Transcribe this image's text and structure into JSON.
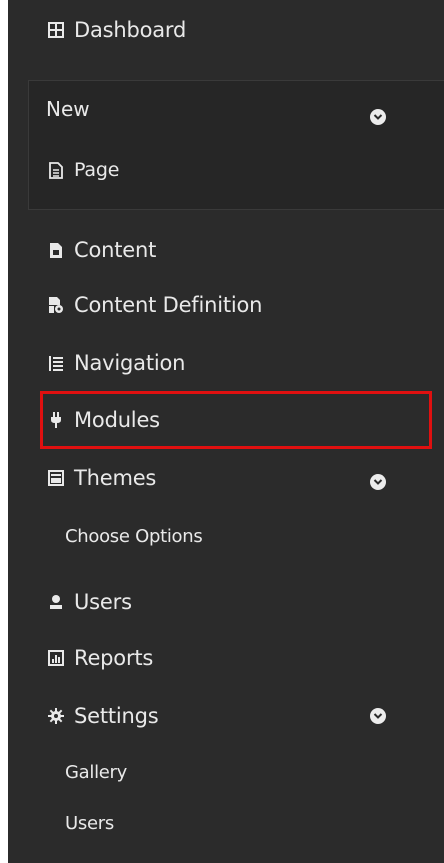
{
  "sidebar": {
    "dashboard": {
      "label": "Dashboard",
      "icon": "dashboard-icon"
    },
    "new_section": {
      "title": "New",
      "items": [
        {
          "label": "Page",
          "icon": "page-icon"
        }
      ]
    },
    "items": [
      {
        "label": "Content",
        "icon": "content-icon"
      },
      {
        "label": "Content Definition",
        "icon": "content-definition-icon"
      },
      {
        "label": "Navigation",
        "icon": "navigation-icon"
      },
      {
        "label": "Modules",
        "icon": "plug-icon",
        "highlighted": true
      },
      {
        "label": "Themes",
        "icon": "themes-icon",
        "expanded": true,
        "children": [
          {
            "label": "Choose Options"
          }
        ]
      },
      {
        "label": "Users",
        "icon": "user-icon"
      },
      {
        "label": "Reports",
        "icon": "reports-icon"
      },
      {
        "label": "Settings",
        "icon": "gear-icon",
        "expanded": true,
        "children": [
          {
            "label": "Gallery"
          },
          {
            "label": "Users"
          }
        ]
      }
    ]
  },
  "colors": {
    "background": "#2b2b2b",
    "text": "#e9e9e9",
    "highlight_border": "#e01010"
  }
}
